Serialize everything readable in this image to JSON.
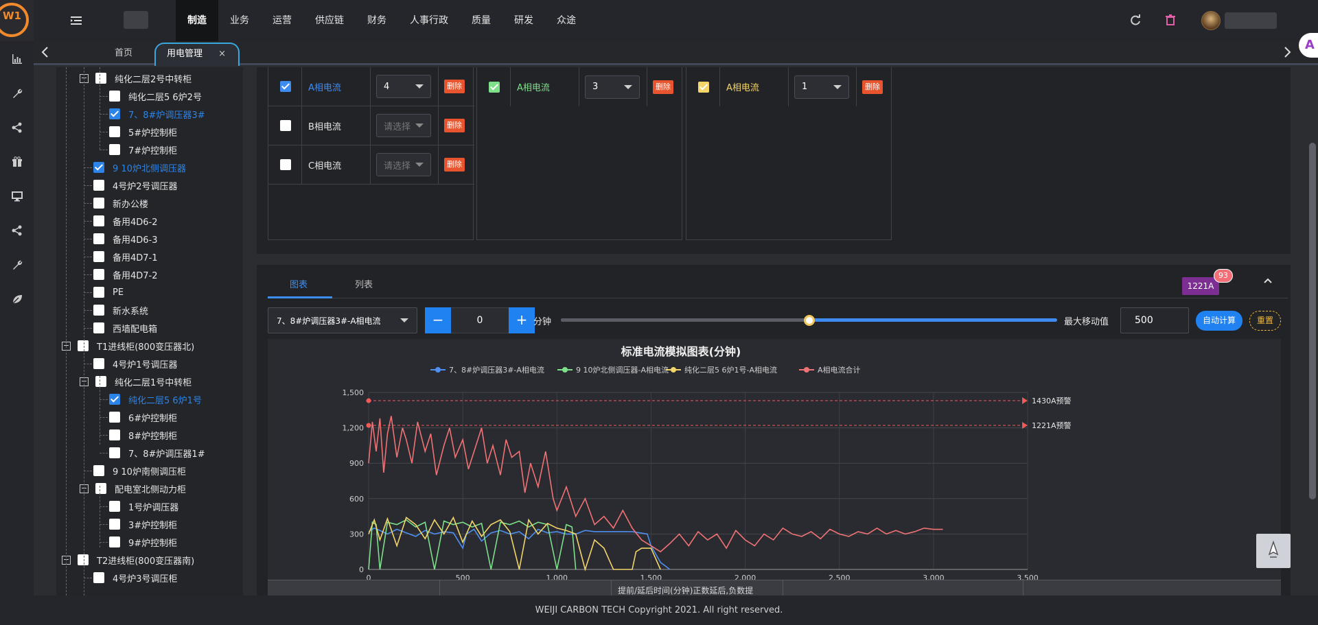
{
  "app": {
    "logo_text": "W1"
  },
  "nav": {
    "items": [
      "制造",
      "业务",
      "运营",
      "供应链",
      "财务",
      "人事行政",
      "质量",
      "研发",
      "众途"
    ],
    "active_index": 0
  },
  "tabs": {
    "home": "首页",
    "active": "用电管理",
    "close": "×"
  },
  "tree": [
    {
      "label": "纯化二层2号中转柜",
      "level": 2,
      "toggle": "−",
      "checked": false
    },
    {
      "label": "纯化二层5 6炉2号",
      "level": 3,
      "checked": false
    },
    {
      "label": "7、8#炉调压器3#",
      "level": 3,
      "checked": true
    },
    {
      "label": "5#炉控制柜",
      "level": 3,
      "checked": false
    },
    {
      "label": "7#炉控制柜",
      "level": 3,
      "checked": false
    },
    {
      "label": "9 10炉北侧调压器",
      "level": 2,
      "checked": true
    },
    {
      "label": "4号炉2号调压器",
      "level": 2,
      "checked": false
    },
    {
      "label": "新办公楼",
      "level": 2,
      "checked": false
    },
    {
      "label": "备用4D6-2",
      "level": 2,
      "checked": false
    },
    {
      "label": "备用4D6-3",
      "level": 2,
      "checked": false
    },
    {
      "label": "备用4D7-1",
      "level": 2,
      "checked": false
    },
    {
      "label": "备用4D7-2",
      "level": 2,
      "checked": false
    },
    {
      "label": "PE",
      "level": 2,
      "checked": false
    },
    {
      "label": "新水系统",
      "level": 2,
      "checked": false
    },
    {
      "label": "西墙配电箱",
      "level": 2,
      "checked": false
    },
    {
      "label": "T1进线柜(800变压器北)",
      "level": 1,
      "toggle": "−",
      "checked": false
    },
    {
      "label": "4号炉1号调压器",
      "level": 2,
      "checked": false
    },
    {
      "label": "纯化二层1号中转柜",
      "level": 2,
      "toggle": "−",
      "checked": false
    },
    {
      "label": "纯化二层5 6炉1号",
      "level": 3,
      "checked": true
    },
    {
      "label": "6#炉控制柜",
      "level": 3,
      "checked": false
    },
    {
      "label": "8#炉控制柜",
      "level": 3,
      "checked": false
    },
    {
      "label": "7、8#炉调压器1#",
      "level": 3,
      "checked": false
    },
    {
      "label": "9 10炉南侧调压柜",
      "level": 2,
      "checked": false
    },
    {
      "label": "配电室北侧动力柜",
      "level": 2,
      "toggle": "−",
      "checked": false
    },
    {
      "label": "1号炉调压器",
      "level": 3,
      "checked": false
    },
    {
      "label": "3#炉控制柜",
      "level": 3,
      "checked": false
    },
    {
      "label": "9#炉控制柜",
      "level": 3,
      "checked": false
    },
    {
      "label": "T2进线柜(800变压器南)",
      "level": 1,
      "toggle": "−",
      "checked": false
    },
    {
      "label": "4号炉3号调压柜",
      "level": 2,
      "checked": false
    }
  ],
  "current_groups": [
    {
      "rows": [
        {
          "label": "A相电流",
          "value": "4",
          "checked": true,
          "color": "#3f8cf0"
        },
        {
          "label": "B相电流",
          "value": "",
          "placeholder": "请选择",
          "checked": false
        },
        {
          "label": "C相电流",
          "value": "",
          "placeholder": "请选择",
          "checked": false
        }
      ]
    },
    {
      "rows": [
        {
          "label": "A相电流",
          "value": "3",
          "checked": true,
          "color": "#7fe08a"
        }
      ]
    },
    {
      "rows": [
        {
          "label": "A相电流",
          "value": "1",
          "checked": true,
          "color": "#f3d56a"
        }
      ]
    }
  ],
  "delete_label": "删除",
  "panel": {
    "tab_chart": "图表",
    "tab_list": "列表",
    "badge_value": "1221A",
    "badge_count": "93",
    "device_select": "7、8#炉调压器3#-A相电流",
    "offset_value": "0",
    "offset_unit": "分钟",
    "slider_fraction": 0.5,
    "max_label": "最大移动值",
    "max_value": "500",
    "auto_btn": "自动计算",
    "reset_btn": "重置"
  },
  "chart_data": {
    "type": "line",
    "title": "标准电流模拟图表(分钟)",
    "xlim": [
      0,
      3500
    ],
    "ylim": [
      0,
      1500
    ],
    "xticks": [
      0,
      500,
      1000,
      1500,
      2000,
      2500,
      3000,
      3500
    ],
    "yticks": [
      0,
      300,
      600,
      900,
      1200,
      1500
    ],
    "xtick_labels": [
      "0",
      "500",
      "1,000",
      "1,500",
      "2,000",
      "2,500",
      "3,000",
      "3,500"
    ],
    "ytick_labels": [
      "0",
      "300",
      "600",
      "900",
      "1,200",
      "1,500"
    ],
    "grid": true,
    "legend_position": "top-center",
    "series": [
      {
        "name": "7、8#炉调压器3#-A相电流",
        "color": "#4e8ff0",
        "x": [
          0,
          30,
          60,
          100,
          150,
          200,
          250,
          300,
          350,
          400,
          450,
          500,
          520,
          560,
          600,
          650,
          700,
          750,
          800,
          850,
          900,
          950,
          1000,
          1050,
          1100,
          1150,
          1200,
          1300,
          1400,
          1480,
          1500,
          1550,
          1600
        ],
        "y": [
          320,
          350,
          330,
          300,
          340,
          310,
          280,
          330,
          300,
          320,
          310,
          180,
          300,
          340,
          240,
          310,
          330,
          300,
          320,
          260,
          340,
          310,
          320,
          300,
          300,
          330,
          320,
          320,
          320,
          300,
          200,
          60,
          0
        ]
      },
      {
        "name": "9 10炉北侧调压器-A相电流",
        "color": "#7fe08a",
        "x": [
          0,
          20,
          40,
          60,
          100,
          150,
          200,
          250,
          300,
          350,
          400,
          450,
          500,
          550,
          600,
          650,
          700,
          750,
          800,
          850,
          900,
          950,
          1000,
          1050,
          1080,
          1100
        ],
        "y": [
          0,
          400,
          380,
          0,
          400,
          380,
          420,
          360,
          400,
          0,
          410,
          380,
          400,
          360,
          390,
          0,
          400,
          380,
          410,
          360,
          400,
          380,
          0,
          380,
          360,
          0
        ]
      },
      {
        "name": "纯化二层5 6炉1号-A相电流",
        "color": "#f3d56a",
        "x": [
          0,
          30,
          60,
          100,
          150,
          200,
          250,
          300,
          350,
          400,
          450,
          500,
          550,
          600,
          650,
          700,
          750,
          800,
          850,
          900,
          950,
          1000,
          1050,
          1100,
          1150,
          1200,
          1250,
          1300,
          1400,
          1420,
          1450,
          1500,
          1550
        ],
        "y": [
          300,
          420,
          250,
          430,
          200,
          440,
          380,
          260,
          420,
          300,
          440,
          230,
          410,
          280,
          380,
          420,
          320,
          0,
          420,
          300,
          390,
          350,
          330,
          300,
          0,
          250,
          180,
          0,
          0,
          150,
          180,
          180,
          0
        ]
      },
      {
        "name": "A相电流合计",
        "color": "#f07275",
        "x": [
          0,
          20,
          40,
          60,
          80,
          100,
          120,
          150,
          180,
          200,
          230,
          260,
          300,
          330,
          360,
          400,
          430,
          460,
          500,
          530,
          560,
          600,
          630,
          660,
          700,
          730,
          760,
          800,
          830,
          860,
          900,
          940,
          980,
          1000,
          1050,
          1100,
          1150,
          1200,
          1250,
          1300,
          1350,
          1400,
          1450,
          1500,
          1550,
          1600,
          1650,
          1700,
          1750,
          1800,
          1850,
          1900,
          1950,
          2000,
          2050,
          2100,
          2150,
          2200,
          2250,
          2300,
          2350,
          2400,
          2450,
          2500,
          2550,
          2600,
          2650,
          2700,
          2750,
          2800,
          2850,
          2900,
          2950,
          3000,
          3050
        ],
        "y": [
          900,
          1250,
          1000,
          1280,
          820,
          1150,
          1300,
          950,
          1200,
          1100,
          900,
          1250,
          1000,
          1150,
          800,
          1050,
          1200,
          950,
          1100,
          850,
          1000,
          1200,
          900,
          1050,
          800,
          1100,
          950,
          1000,
          650,
          900,
          700,
          1000,
          600,
          500,
          700,
          450,
          600,
          380,
          450,
          350,
          500,
          350,
          250,
          200,
          150,
          220,
          300,
          200,
          320,
          250,
          300,
          180,
          330,
          250,
          200,
          300,
          250,
          350,
          300,
          280,
          320,
          260,
          340,
          300,
          280,
          320,
          300,
          350,
          300,
          330,
          300,
          320,
          350,
          340,
          340
        ]
      }
    ],
    "markers": [
      {
        "label": "1430A预警",
        "value": 1430
      },
      {
        "label": "1221A预警",
        "value": 1221
      }
    ]
  },
  "bottom_table": {
    "header": "提前/延后时间(分钟)正数延后,负数提"
  },
  "footer": {
    "text": "WEIJI CARBON TECH Copyright 2021. All right reserved."
  }
}
